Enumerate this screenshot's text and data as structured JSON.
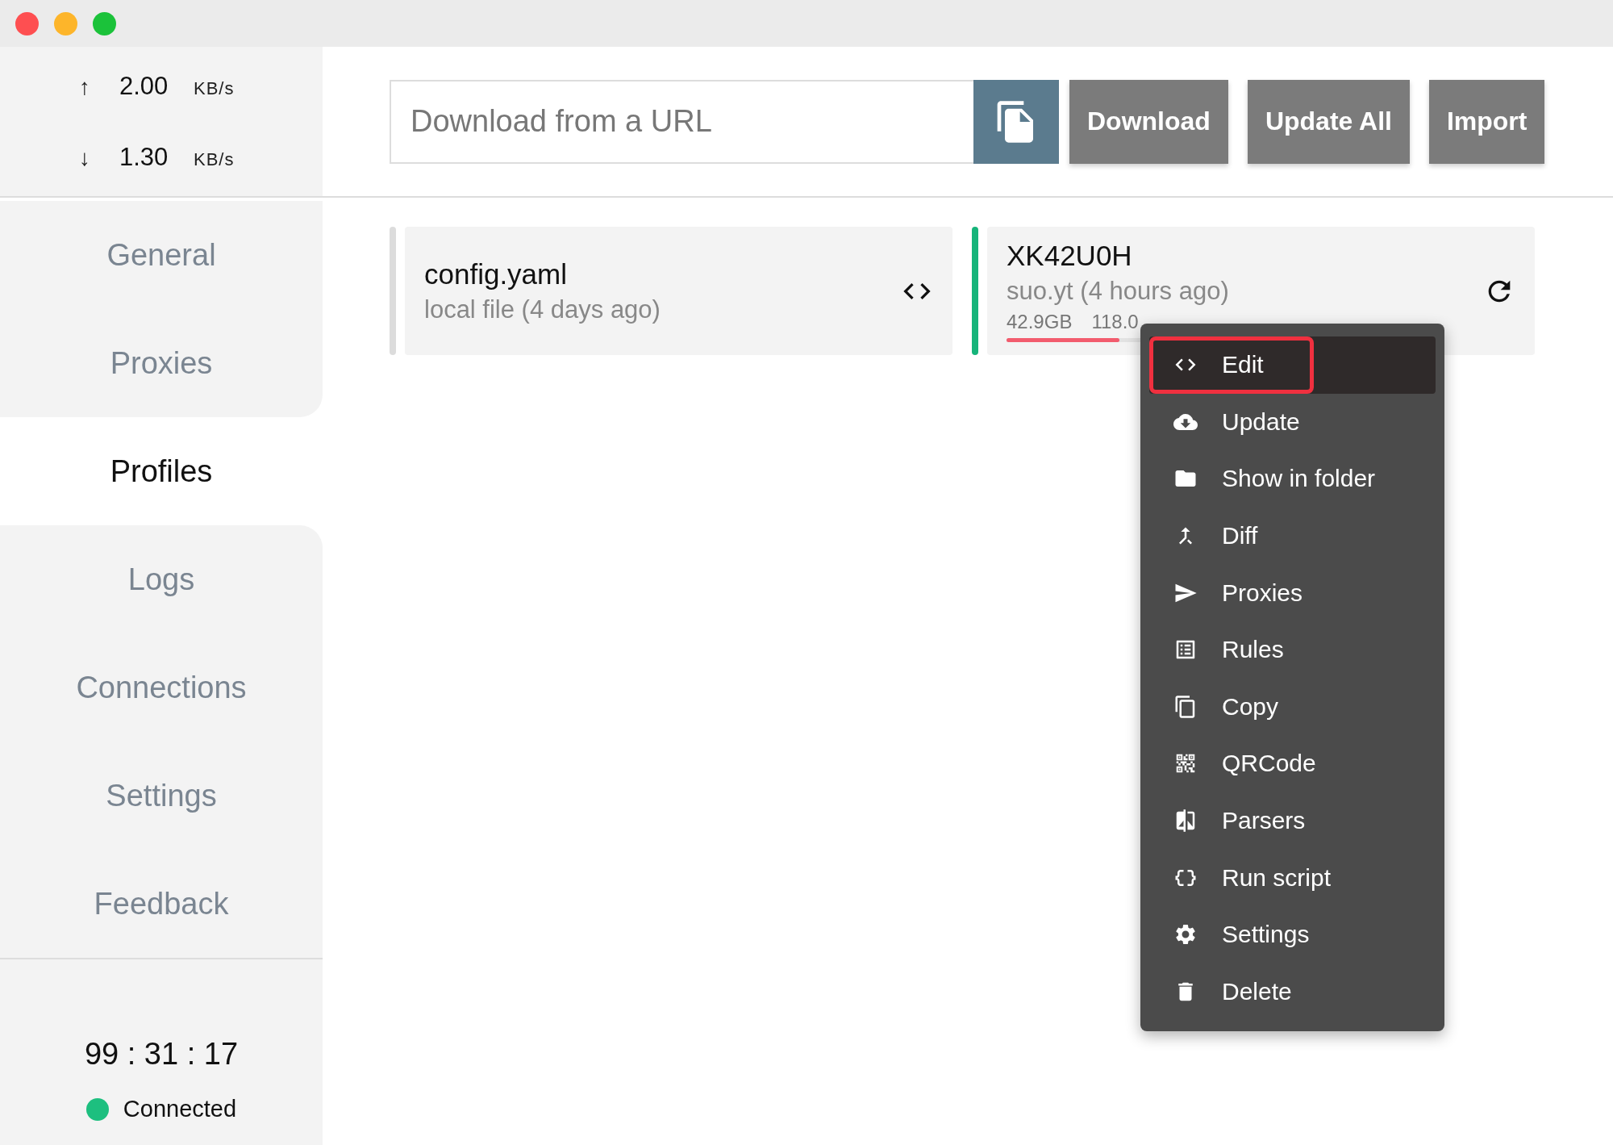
{
  "traffic": {
    "upload": {
      "arrow": "↑",
      "value": "2.00",
      "unit": "KB/s"
    },
    "download": {
      "arrow": "↓",
      "value": "1.30",
      "unit": "KB/s"
    }
  },
  "nav": [
    {
      "label": "General",
      "selected": false
    },
    {
      "label": "Proxies",
      "selected": false
    },
    {
      "label": "Profiles",
      "selected": true
    },
    {
      "label": "Logs",
      "selected": false
    },
    {
      "label": "Connections",
      "selected": false
    },
    {
      "label": "Settings",
      "selected": false
    },
    {
      "label": "Feedback",
      "selected": false
    }
  ],
  "uptime": "99 : 31 : 17",
  "status": {
    "label": "Connected",
    "color": "#1dbf7f"
  },
  "url_field": {
    "placeholder": "Download from a URL"
  },
  "buttons": [
    "Download",
    "Update All",
    "Import"
  ],
  "profiles": [
    {
      "kind": "local",
      "name": "config.yaml",
      "source": "local file (4 days ago)",
      "selected": false
    },
    {
      "kind": "remote",
      "name": "XK42U0H",
      "source": "suo.yt (4 hours ago)",
      "usage": [
        "42.9GB",
        "118.0"
      ],
      "level": 0.35,
      "selected": true
    }
  ],
  "context_menu": [
    {
      "label": "Edit",
      "selected": true,
      "highlighted": true
    },
    {
      "label": "Update",
      "selected": false,
      "highlighted": false
    },
    {
      "label": "Show in folder",
      "selected": false,
      "highlighted": false
    },
    {
      "label": "Diff",
      "selected": false,
      "highlighted": false
    },
    {
      "label": "Proxies",
      "selected": false,
      "highlighted": false
    },
    {
      "label": "Rules",
      "selected": false,
      "highlighted": false
    },
    {
      "label": "Copy",
      "selected": false,
      "highlighted": false
    },
    {
      "label": "QRCode",
      "selected": false,
      "highlighted": false
    },
    {
      "label": "Parsers",
      "selected": false,
      "highlighted": false
    },
    {
      "label": "Run script",
      "selected": false,
      "highlighted": false
    },
    {
      "label": "Settings",
      "selected": false,
      "highlighted": false
    },
    {
      "label": "Delete",
      "selected": false,
      "highlighted": false
    }
  ]
}
